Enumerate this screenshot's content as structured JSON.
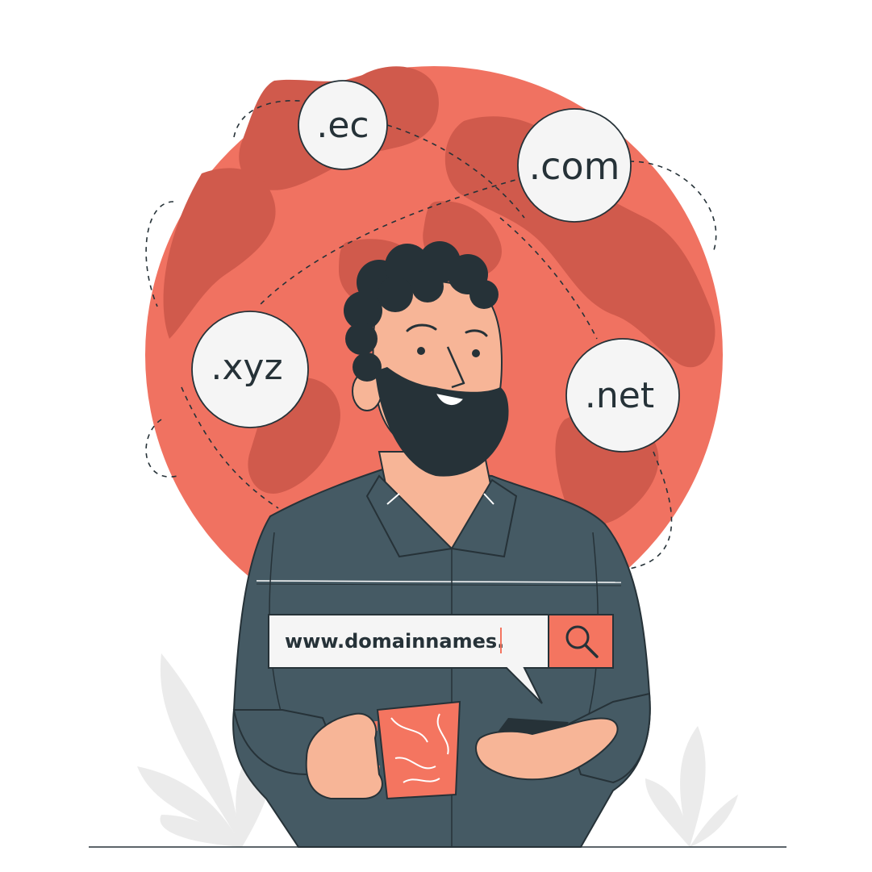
{
  "domains": {
    "ec": ".ec",
    "com": ".com",
    "xyz": ".xyz",
    "net": ".net"
  },
  "search": {
    "value": "www.domainnames."
  },
  "icons": {
    "search": "magnifier-icon"
  },
  "colors": {
    "accent": "#F47560",
    "globe": "#F07261",
    "continents": "#D05A4C",
    "shirt": "#455A64",
    "dark": "#263238",
    "skin": "#F7B597",
    "leaf": "#EBEBEB"
  }
}
